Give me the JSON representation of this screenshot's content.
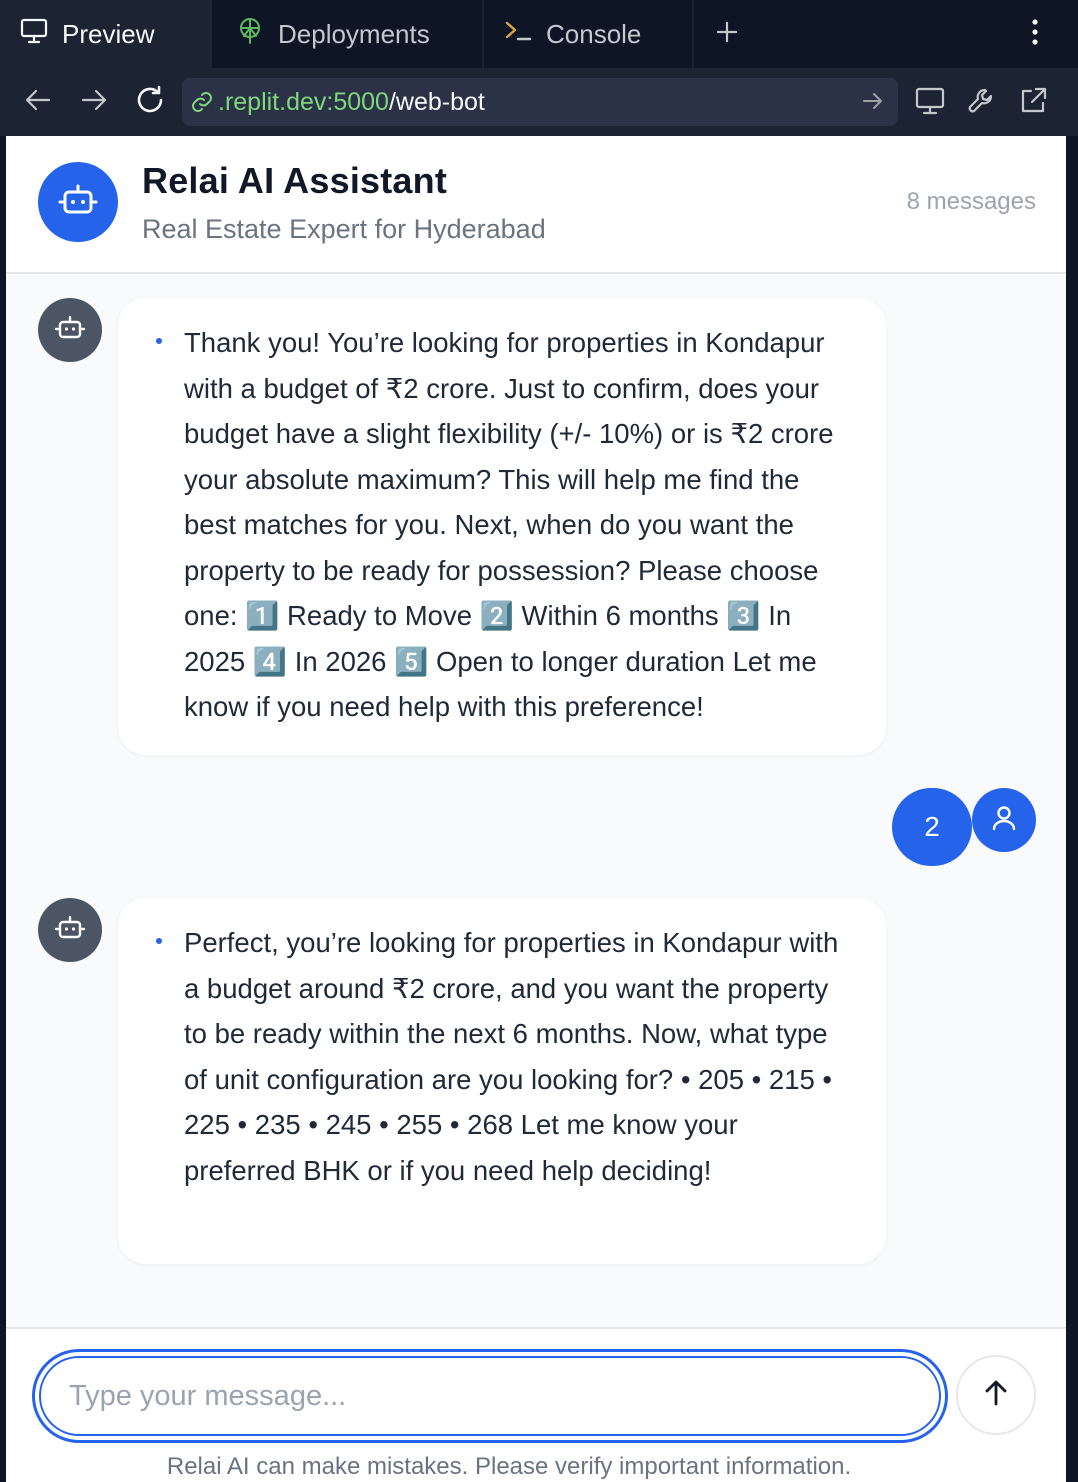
{
  "ide": {
    "tabs": [
      {
        "label": "Preview",
        "icon": "monitor-icon"
      },
      {
        "label": "Deployments",
        "icon": "deployments-icon"
      },
      {
        "label": "Console",
        "icon": "terminal-icon"
      }
    ],
    "add_tab": "+",
    "url": {
      "host": ".replit.dev:5000",
      "path": "/web-bot"
    }
  },
  "app": {
    "title": "Relai AI Assistant",
    "subtitle": "Real Estate Expert for Hyderabad",
    "message_count": "8 messages",
    "messages": [
      {
        "role": "bot",
        "text": "Thank you! You’re looking for properties in Kondapur with a budget of ₹2 crore. Just to confirm, does your budget have a slight flexibility (+/- 10%) or is ₹2 crore your absolute maximum? This will help me find the best matches for you. Next, when do you want the property to be ready for possession? Please choose one: 1️⃣ Ready to Move 2️⃣ Within 6 months 3️⃣ In 2025 4️⃣ In 2026 5️⃣ Open to longer duration Let me know if you need help with this preference!"
      },
      {
        "role": "user",
        "text": "2"
      },
      {
        "role": "bot",
        "text": "Perfect, you’re looking for properties in Kondapur with a budget around ₹2 crore, and you want the property to be ready within the next 6 months. Now, what type of unit configuration are you looking for? • 205 • 215 • 225 • 235 • 245 • 255 • 268 Let me know your preferred BHK or if you need help deciding!"
      }
    ],
    "input_placeholder": "Type your message...",
    "disclaimer": "Relai AI can make mistakes. Please verify important information."
  },
  "colors": {
    "accent": "#2563eb",
    "bot_avatar": "#4b5563",
    "chrome_bg": "#0e1525"
  }
}
